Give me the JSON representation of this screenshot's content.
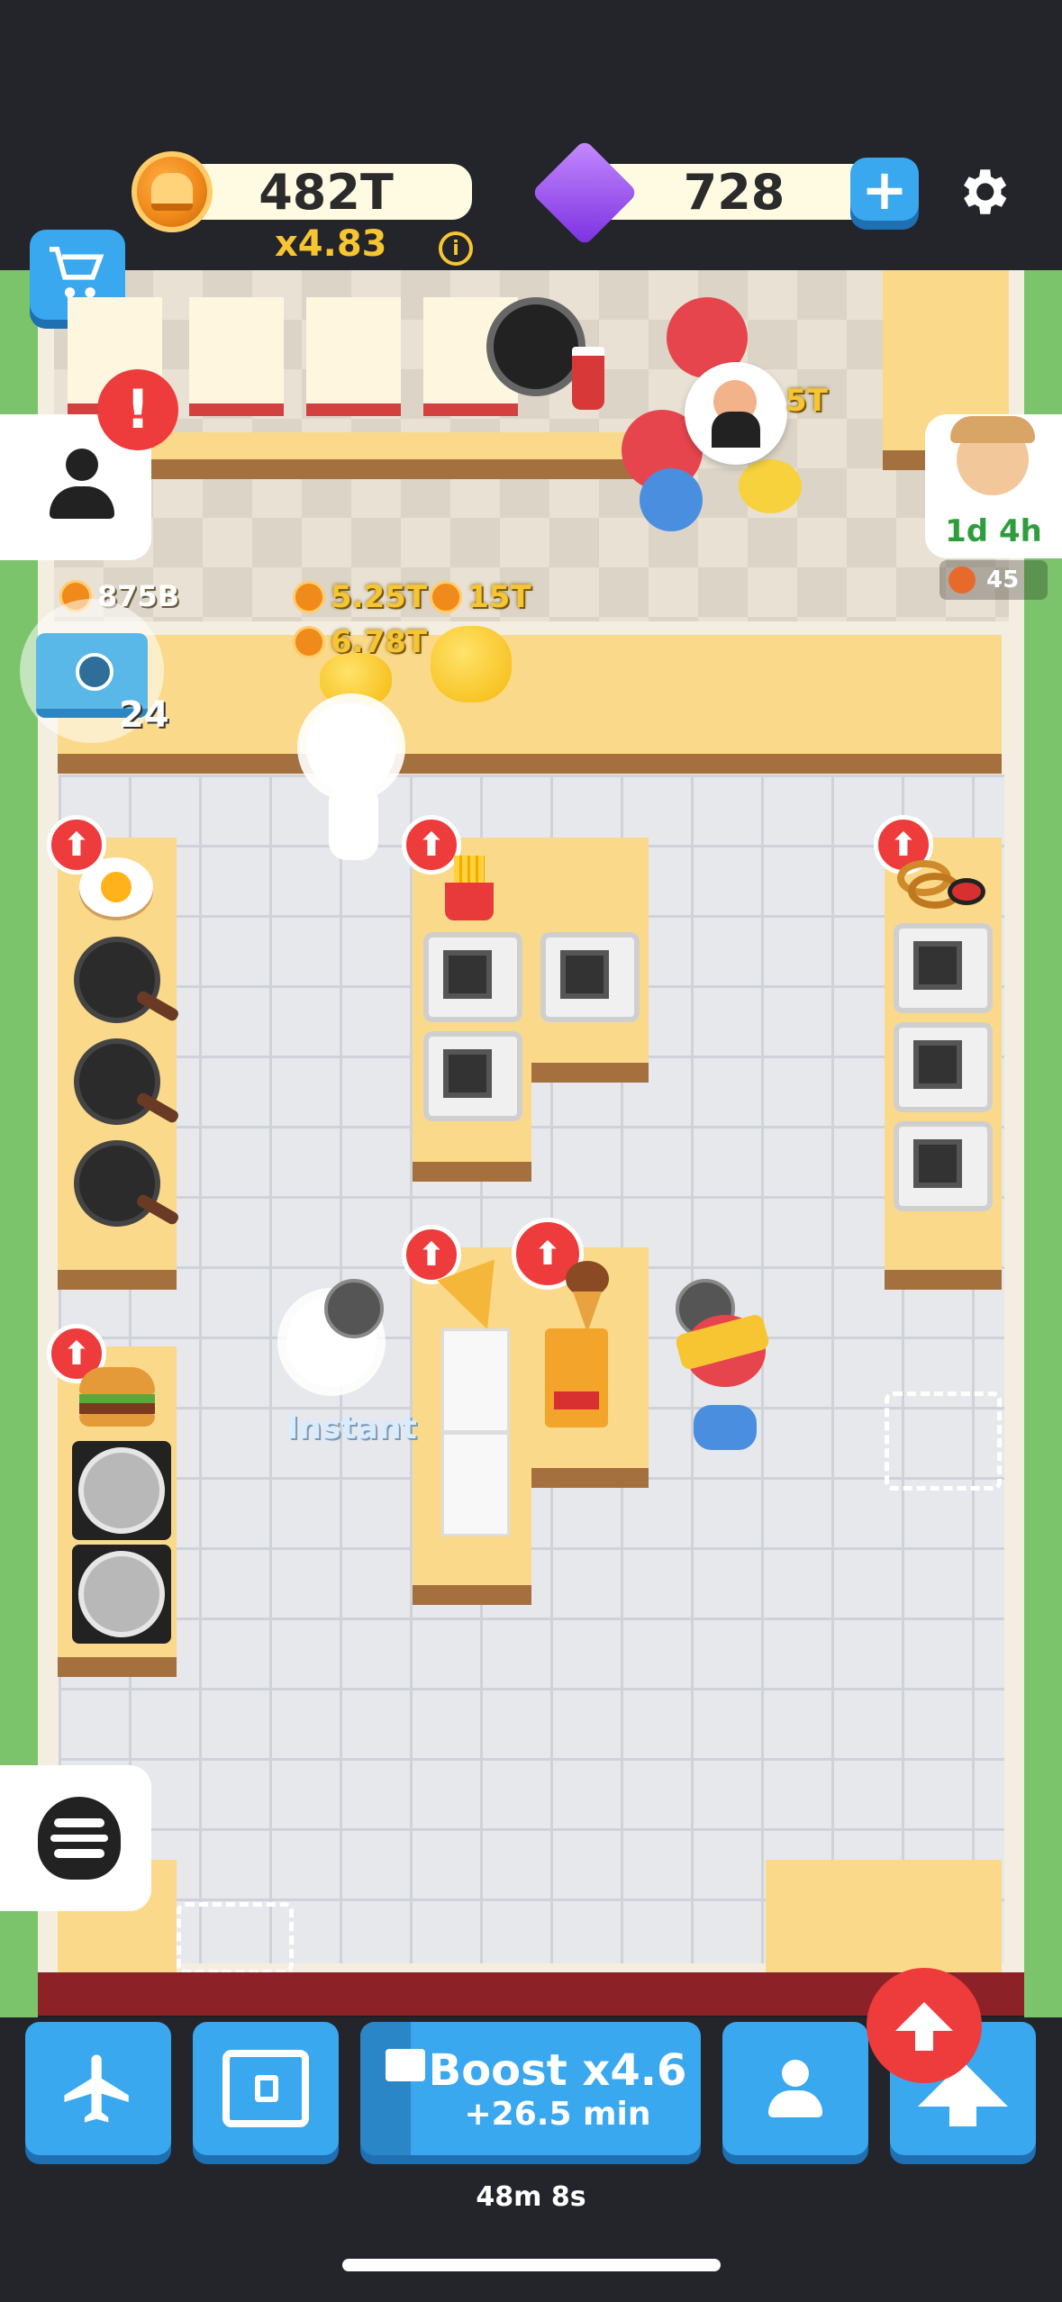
{
  "header": {
    "coins": "482T",
    "multiplier": "x4.83",
    "info_icon": "info-icon",
    "gems": "728",
    "add_label": "+",
    "settings_icon": "gear-icon",
    "shop_icon": "shopping-cart-icon"
  },
  "dining": {
    "tip_amount": "5T",
    "alert": "!"
  },
  "pickup_counter": {
    "earnings": [
      "5.25T",
      "15T",
      "6.78T"
    ],
    "safe_value": "875B",
    "safe_level": "24"
  },
  "sidebar_right": {
    "timer": "1d 4h",
    "points": "45"
  },
  "kitchen": {
    "stations": [
      {
        "item": "fried-egg-icon"
      },
      {
        "item": "fries-icon"
      },
      {
        "item": "onion-rings-icon"
      },
      {
        "item": "burger-icon"
      },
      {
        "item": "pizza-icon"
      },
      {
        "item": "ice-cream-icon"
      }
    ],
    "chef_status": "Instant"
  },
  "bottom_nav": {
    "boost_label": "Boost x4.6",
    "boost_sub": "+26.5 min",
    "boost_timer": "48m 8s",
    "plane_icon": "airplane-icon",
    "vault_icon": "vault-icon",
    "staff_icon": "person-icon",
    "upgrade_icon": "arrow-up-icon"
  },
  "colors": {
    "accent_blue": "#3aa8ee",
    "alert_red": "#ee3b3b",
    "gold_text": "#f7c531",
    "timer_green": "#2e9e3c"
  }
}
